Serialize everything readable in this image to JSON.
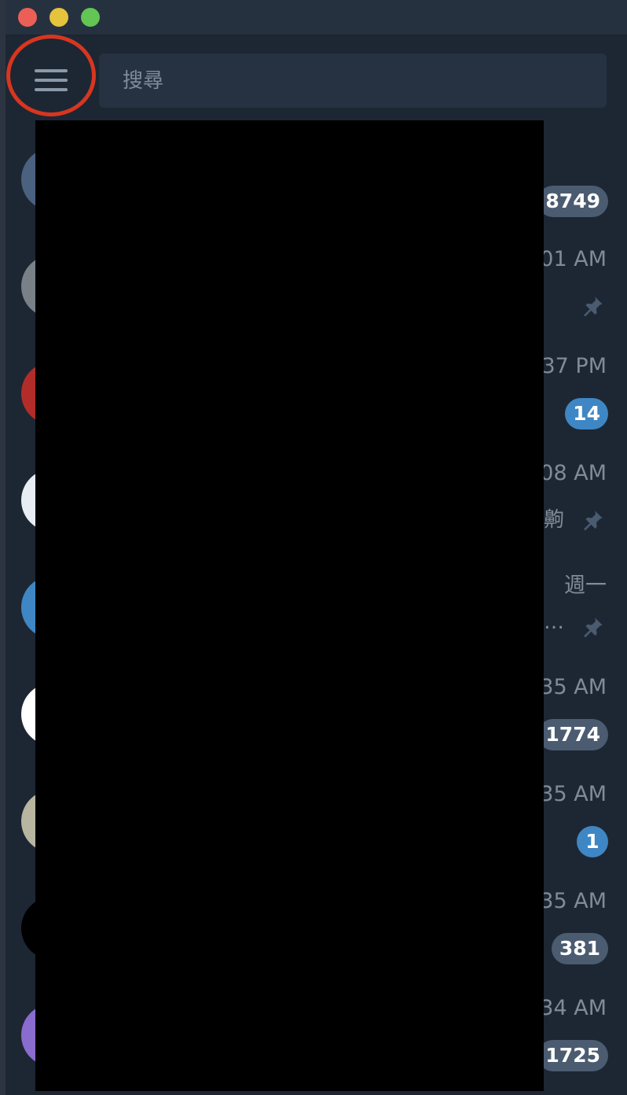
{
  "window": {
    "traffic_lights": [
      "close",
      "minimize",
      "maximize"
    ]
  },
  "header": {
    "menu_icon": "hamburger-menu-icon",
    "search": {
      "placeholder": "搜尋",
      "value": ""
    }
  },
  "chats": [
    {
      "time": "",
      "badge": "8749",
      "badge_style": "muted",
      "avatar_color": "#4a6180"
    },
    {
      "time": "01 AM",
      "pinned": true,
      "avatar_color": "#7a8088"
    },
    {
      "time": "37 PM",
      "badge": "14",
      "badge_style": "active",
      "avatar_color": "#b22d2a"
    },
    {
      "time": "08 AM",
      "preview_tail": "齁",
      "pinned": true,
      "avatar_color": "#e7edf3"
    },
    {
      "time": "週一",
      "preview_tail": "…",
      "pinned": true,
      "avatar_color": "#3f87c4"
    },
    {
      "time": "35 AM",
      "badge": "1774",
      "badge_style": "muted",
      "avatar_color": "#ffffff"
    },
    {
      "time": "35 AM",
      "badge": "1",
      "badge_style": "active",
      "avatar_color": "#b8b5a0"
    },
    {
      "time": "35 AM",
      "badge": "381",
      "badge_style": "muted",
      "avatar_color": "#000000"
    },
    {
      "time": "34 AM",
      "badge": "1725",
      "badge_style": "muted",
      "avatar_color": "#8a6ccf"
    }
  ],
  "colors": {
    "background": "#1d2733",
    "annotation_ring": "#d8361f",
    "badge_muted": "#4b5b70",
    "badge_active": "#3f87c4"
  }
}
